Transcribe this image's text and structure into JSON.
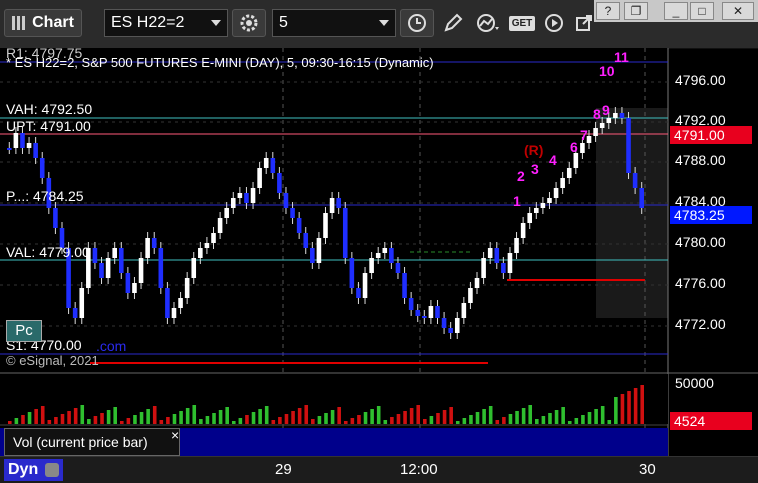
{
  "toolbar": {
    "app_label": "Chart",
    "symbol": "ES H22=2",
    "interval": "5",
    "icons": [
      "grid-icon",
      "gear-icon",
      "clock-icon",
      "pencil-icon",
      "indicator-icon",
      "get-icon",
      "play-icon",
      "export-icon"
    ]
  },
  "window_controls": [
    "?",
    "❐",
    "_",
    "□",
    "✕"
  ],
  "chart": {
    "header_r1": "R1: 4797.75",
    "title": "* ES H22=2, S&P 500 FUTURES E-MINI (DAY), 5, 09:30-16:15 (Dynamic)",
    "vah": "VAH: 4792.50",
    "upt": "UPT: 4791.00",
    "pivot": "P...: 4784.25",
    "val": "VAL: 4779.00",
    "s1": "S1: 4770.00",
    "watermark": "© eSignal, 2021",
    "watermark2": ".com",
    "pc_button": "Pc",
    "price_ticks": [
      "4796.00",
      "4792.00",
      "4788.00",
      "4784.00",
      "4780.00",
      "4776.00",
      "4772.00"
    ],
    "upt_box": "4791.00",
    "last_box": "4783.25",
    "colors": {
      "upt": "#e8001e",
      "last": "#0018ff",
      "vah_line": "#40c0c0",
      "pivot_line": "#2a2acc",
      "val_line": "#40c0c0",
      "support": "#e00000"
    },
    "counts_magenta": [
      "1",
      "2",
      "3",
      "4",
      "6",
      "7",
      "8",
      "9",
      "10",
      "11"
    ],
    "counts_red": "(R)"
  },
  "volume": {
    "label": "Vol (current price bar)",
    "tick": "50000",
    "box": "4524",
    "close_icon": "×"
  },
  "chart_data": {
    "type": "candlestick",
    "ylim": [
      4770,
      4798
    ],
    "x_ticks": [
      "29",
      "12:00",
      "30"
    ],
    "levels": {
      "R1": 4797.75,
      "VAH": 4792.5,
      "UPT": 4791.0,
      "Pivot": 4784.25,
      "VAL": 4779.0,
      "S1": 4770.0
    },
    "last_price": 4783.25,
    "volume_scale_tick": 50000,
    "last_volume": 4524
  },
  "bottom": {
    "label": "Dyn",
    "times": [
      "29",
      "12:00",
      "30"
    ]
  }
}
